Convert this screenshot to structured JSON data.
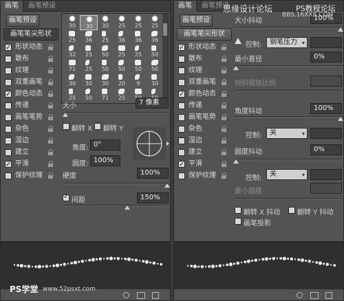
{
  "watermark": {
    "top_site_1": "思缘设计论坛",
    "top_site_2": "PS教程论坛",
    "top_url": "BBS.16XX8.COM",
    "bottom_brand": "PS学堂",
    "bottom_url": "www.52psxt.com"
  },
  "left_panel": {
    "tabs": [
      "画笔",
      "画笔预设"
    ],
    "preset_button": "画笔预设",
    "tip_shape_button": "画笔笔尖形状",
    "options": [
      {
        "label": "形状动态",
        "checked": true,
        "lock": true
      },
      {
        "label": "散布",
        "checked": false,
        "lock": true
      },
      {
        "label": "纹理",
        "checked": false,
        "lock": true
      },
      {
        "label": "双重画笔",
        "checked": false,
        "lock": true
      },
      {
        "label": "颜色动态",
        "checked": true,
        "lock": true
      },
      {
        "label": "传递",
        "checked": false,
        "lock": true
      },
      {
        "label": "画笔笔势",
        "checked": false,
        "lock": true
      },
      {
        "label": "杂色",
        "checked": false,
        "lock": true
      },
      {
        "label": "湿边",
        "checked": false,
        "lock": true
      },
      {
        "label": "建立",
        "checked": false,
        "lock": true
      },
      {
        "label": "平滑",
        "checked": true,
        "lock": true
      },
      {
        "label": "保护纹理",
        "checked": false,
        "lock": true
      }
    ],
    "brush_sizes": [
      [
        "30",
        "30",
        "30",
        "25",
        "25",
        "25"
      ],
      [
        "25",
        "36",
        "25",
        "36",
        "36",
        "36"
      ],
      [
        "32",
        "25",
        "50",
        "25",
        "25",
        "50"
      ],
      [
        "71",
        "25",
        "50",
        "50",
        "50",
        "50"
      ],
      [
        "36",
        "30",
        "30",
        "20",
        "9",
        "30"
      ],
      [
        "25",
        "50",
        "71",
        "25",
        "50",
        "50"
      ]
    ],
    "size_label": "大小",
    "size_value": "7 像素",
    "flip_x": "翻转 X",
    "flip_y": "翻转 Y",
    "angle_label": "角度:",
    "angle_value": "0°",
    "roundness_label": "圆度:",
    "roundness_value": "100%",
    "hardness_label": "硬度",
    "hardness_value": "100%",
    "spacing_label": "间距",
    "spacing_value": "150%",
    "spacing_checked": true
  },
  "right_panel": {
    "tabs": [
      "画笔",
      "画笔预设"
    ],
    "preset_button": "画笔预设",
    "tip_shape_button": "画笔笔尖形状",
    "options": [
      {
        "label": "形状动态",
        "checked": true,
        "lock": true
      },
      {
        "label": "散布",
        "checked": false,
        "lock": true
      },
      {
        "label": "纹理",
        "checked": false,
        "lock": true
      },
      {
        "label": "双重画笔",
        "checked": false,
        "lock": true
      },
      {
        "label": "颜色动态",
        "checked": true,
        "lock": true
      },
      {
        "label": "传递",
        "checked": false,
        "lock": true
      },
      {
        "label": "画笔笔势",
        "checked": false,
        "lock": true
      },
      {
        "label": "杂色",
        "checked": false,
        "lock": true
      },
      {
        "label": "湿边",
        "checked": false,
        "lock": true
      },
      {
        "label": "建立",
        "checked": false,
        "lock": true
      },
      {
        "label": "平滑",
        "checked": true,
        "lock": true
      },
      {
        "label": "保护纹理",
        "checked": false,
        "lock": true
      }
    ],
    "size_jitter_label": "大小抖动",
    "size_jitter_value": "100%",
    "control_label": "控制:",
    "control_value_1": "钢笔压力",
    "min_diameter_label": "最小直径",
    "min_diameter_value": "0%",
    "tilt_scale_label": "倾斜缩放比例",
    "angle_jitter_label": "角度抖动",
    "angle_jitter_value": "100%",
    "control_value_2": "关",
    "roundness_jitter_label": "圆度抖动",
    "roundness_jitter_value": "0%",
    "control_value_3": "关",
    "min_roundness_label": "最小圆度",
    "flip_x_jitter": "翻转 X 抖动",
    "flip_y_jitter": "翻转 Y 抖动",
    "brush_projection": "画笔投影"
  }
}
